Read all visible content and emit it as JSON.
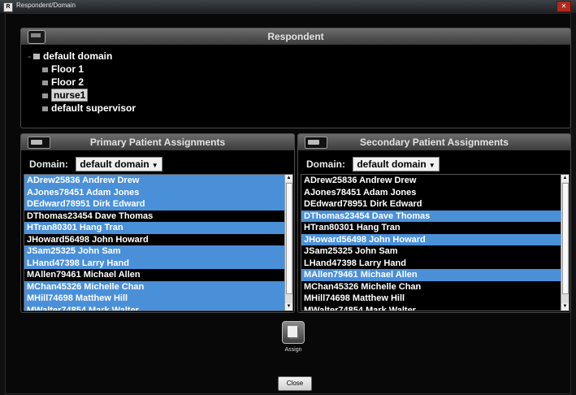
{
  "window": {
    "title": "Respondent/Domain",
    "icon_letter": "R"
  },
  "respondent": {
    "header": "Respondent",
    "tree": [
      {
        "label": "default domain",
        "indent": 0,
        "selected": false
      },
      {
        "label": "Floor 1",
        "indent": 1,
        "selected": false
      },
      {
        "label": "Floor 2",
        "indent": 1,
        "selected": false
      },
      {
        "label": "nurse1",
        "indent": 1,
        "selected": true
      },
      {
        "label": "default supervisor",
        "indent": 1,
        "selected": false
      }
    ]
  },
  "primary": {
    "header": "Primary Patient Assignments",
    "domain_label": "Domain:",
    "domain_value": "default domain",
    "patients": [
      {
        "label": "ADrew25836 Andrew Drew",
        "selected": true
      },
      {
        "label": "AJones78451 Adam Jones",
        "selected": true
      },
      {
        "label": "DEdward78951 Dirk Edward",
        "selected": true
      },
      {
        "label": "DThomas23454 Dave Thomas",
        "selected": false
      },
      {
        "label": "HTran80301 Hang Tran",
        "selected": true
      },
      {
        "label": "JHoward56498 John Howard",
        "selected": false
      },
      {
        "label": "JSam25325 John Sam",
        "selected": true
      },
      {
        "label": "LHand47398 Larry Hand",
        "selected": true
      },
      {
        "label": "MAllen79461 Michael Allen",
        "selected": false
      },
      {
        "label": "MChan45326 Michelle Chan",
        "selected": true
      },
      {
        "label": "MHill74698 Matthew Hill",
        "selected": true
      },
      {
        "label": "MWalter74854 Mark Walter",
        "selected": true
      }
    ]
  },
  "secondary": {
    "header": "Secondary Patient Assignments",
    "domain_label": "Domain:",
    "domain_value": "default domain",
    "patients": [
      {
        "label": "ADrew25836 Andrew Drew",
        "selected": false
      },
      {
        "label": "AJones78451 Adam Jones",
        "selected": false
      },
      {
        "label": "DEdward78951 Dirk Edward",
        "selected": false
      },
      {
        "label": "DThomas23454 Dave Thomas",
        "selected": true
      },
      {
        "label": "HTran80301 Hang Tran",
        "selected": false
      },
      {
        "label": "JHoward56498 John Howard",
        "selected": true
      },
      {
        "label": "JSam25325 John Sam",
        "selected": false
      },
      {
        "label": "LHand47398 Larry Hand",
        "selected": false
      },
      {
        "label": "MAllen79461 Michael Allen",
        "selected": true
      },
      {
        "label": "MChan45326 Michelle Chan",
        "selected": false
      },
      {
        "label": "MHill74698 Matthew Hill",
        "selected": false
      },
      {
        "label": "MWalter74854 Mark Walter",
        "selected": false
      }
    ]
  },
  "actions": {
    "assign_label": "Assign",
    "close_label": "Close"
  },
  "colors": {
    "selection": "#4a90d9",
    "background": "#000000"
  }
}
